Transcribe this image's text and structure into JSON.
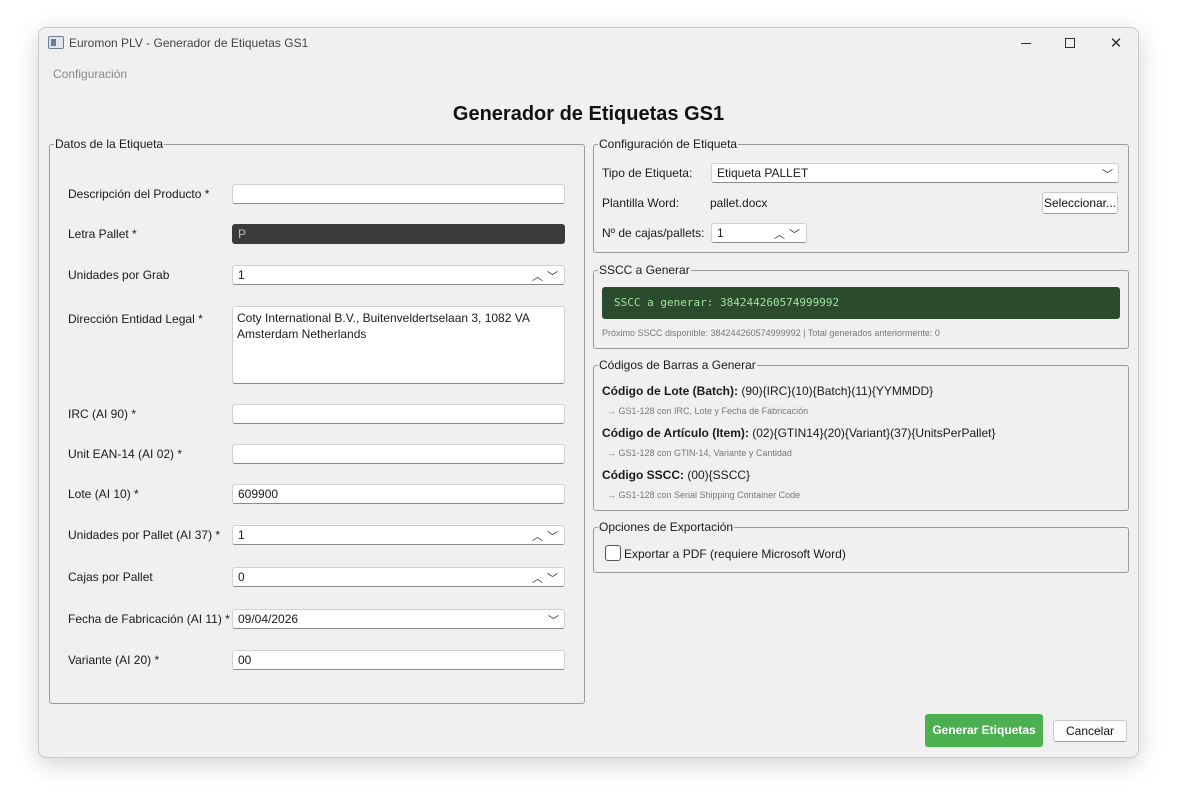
{
  "window": {
    "title": "Euromon PLV - Generador de Etiquetas GS1"
  },
  "menu": {
    "config": "Configuración"
  },
  "main_title": "Generador de Etiquetas GS1",
  "left": {
    "legend": "Datos de la Etiqueta",
    "fields": [
      {
        "label": "Descripción del Producto *",
        "value": ""
      },
      {
        "label": "Letra Pallet *",
        "value": "P"
      },
      {
        "label": "Unidades por Grab",
        "value": "1"
      },
      {
        "label": "Dirección Entidad Legal *",
        "value": "Coty International B.V., Buitenveldertselaan 3, 1082 VA\nAmsterdam Netherlands"
      },
      {
        "label": "IRC (AI 90) *",
        "value": ""
      },
      {
        "label": "Unit EAN-14 (AI 02) *",
        "value": ""
      },
      {
        "label": "Lote (AI 10) *",
        "value": "609900"
      },
      {
        "label": "Unidades por Pallet (AI 37) *",
        "value": "1"
      },
      {
        "label": "Cajas por Pallet",
        "value": "0"
      },
      {
        "label": "Fecha de Fabricación (AI 11) *",
        "value": "09/04/2026"
      },
      {
        "label": "Variante (AI 20) *",
        "value": "00"
      }
    ]
  },
  "config": {
    "legend": "Configuración de Etiqueta",
    "tipo_label": "Tipo de Etiqueta:",
    "tipo_value": "Etiqueta PALLET",
    "plantilla_label": "Plantilla Word:",
    "plantilla_value": "pallet.docx",
    "select_button": "Seleccionar...",
    "cajas_label": "Nº de cajas/pallets:",
    "cajas_value": "1"
  },
  "sscc": {
    "legend": "SSCC a Generar",
    "display": "SSCC a generar: 384244260574999992",
    "note": "Próximo SSCC disponible: 384244260574999992 | Total generados anteriormente: 0"
  },
  "codes": {
    "legend": "Códigos de Barras a Generar",
    "items": [
      {
        "title": "Código de Lote (Batch):",
        "format": " (90){IRC}(10){Batch}(11){YYMMDD}",
        "desc": "→ GS1-128 con IRC, Lote y Fecha de Fabricación"
      },
      {
        "title": "Código de Artículo (Item):",
        "format": " (02){GTIN14}(20){Variant}(37){UnitsPerPallet}",
        "desc": "→ GS1-128 con GTIN-14, Variante y Cantidad"
      },
      {
        "title": "Código SSCC:",
        "format": " (00){SSCC}",
        "desc": "→ GS1-128 con Serial Shipping Container Code"
      }
    ]
  },
  "export": {
    "legend": "Opciones de Exportación",
    "pdf_label": "Exportar a PDF (requiere Microsoft Word)",
    "pdf_checked": false
  },
  "buttons": {
    "generate": "Generar Etiquetas",
    "cancel": "Cancelar"
  },
  "icons": {
    "minimize": "minimize-icon",
    "maximize": "maximize-icon",
    "close": "close-icon",
    "spin": "spin-arrows-icon",
    "dropdown": "chevron-down-icon"
  },
  "colors": {
    "primary": "#4caf50",
    "sscc_bg": "#2c4a2c",
    "sscc_text": "#9fe49f"
  }
}
